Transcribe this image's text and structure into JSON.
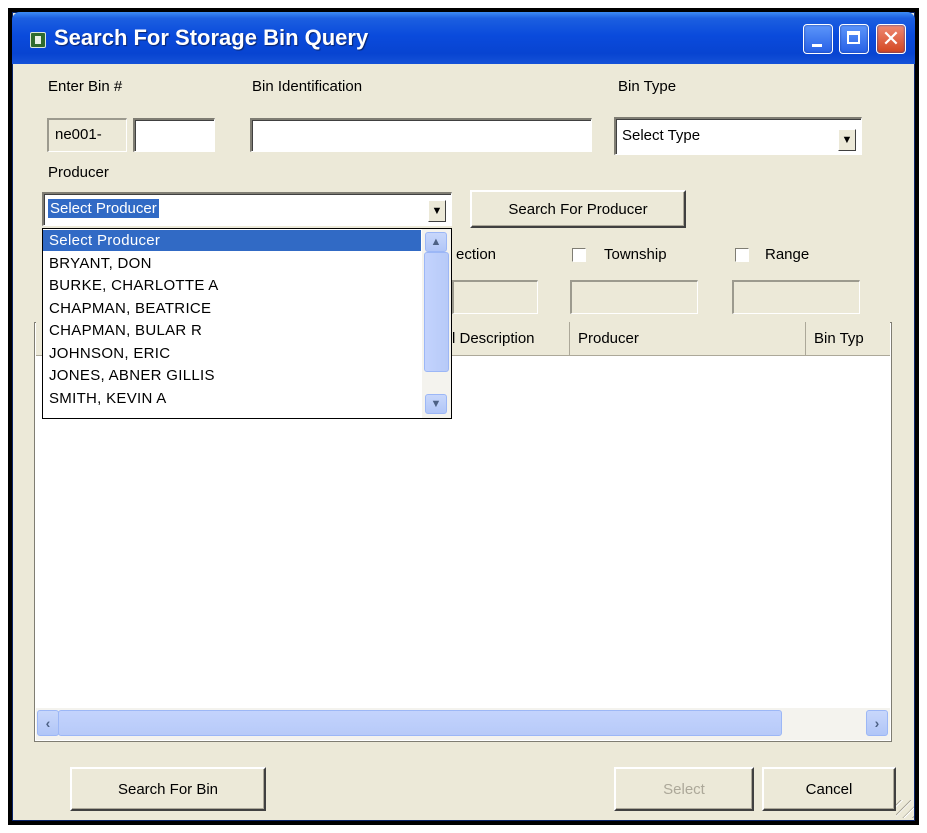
{
  "window": {
    "title": "Search For Storage Bin Query",
    "controls": {
      "minimize": "minimize-icon",
      "maximize": "maximize-icon",
      "close": "close-icon"
    }
  },
  "form": {
    "bin_number_label": "Enter Bin #",
    "bin_prefix": "ne001-",
    "bin_number_value": "",
    "bin_identification_label": "Bin Identification",
    "bin_identification_value": "",
    "bin_type_label": "Bin Type",
    "bin_type_selected": "Select Type",
    "producer_label": "Producer",
    "producer_selected": "Select Producer",
    "search_producer_button": "Search For Producer",
    "section_label": "ection",
    "township_label": "Township",
    "range_label": "Range"
  },
  "producer_options": [
    "Select Producer",
    "BRYANT, DON",
    "BURKE, CHARLOTTE A",
    "CHAPMAN, BEATRICE",
    "CHAPMAN, BULAR R",
    "JOHNSON, ERIC",
    "JONES, ABNER GILLIS",
    "SMITH, KEVIN A"
  ],
  "results_table": {
    "columns": [
      "l Description",
      "Producer",
      "Bin Typ"
    ],
    "rows": []
  },
  "footer": {
    "search_bin_button": "Search For Bin",
    "select_button": "Select",
    "cancel_button": "Cancel"
  },
  "colors": {
    "titlebar": "#0a4bdc",
    "selection": "#316ac5",
    "dialog_bg": "#ece9d8"
  }
}
